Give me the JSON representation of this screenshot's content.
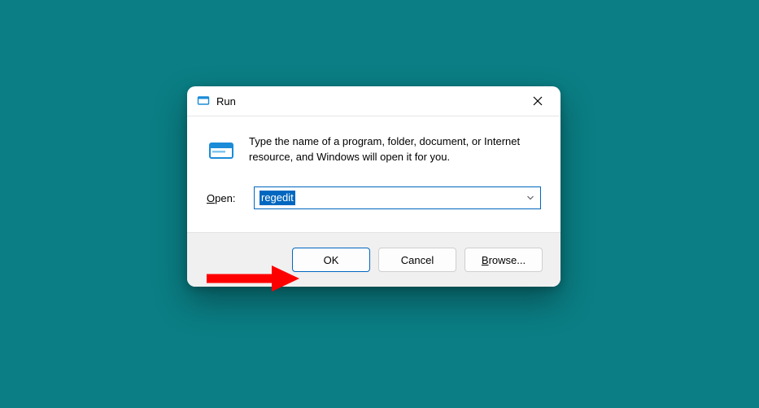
{
  "dialog": {
    "title": "Run",
    "instruction": "Type the name of a program, folder, document, or Internet resource, and Windows will open it for you.",
    "open_label_pre": "O",
    "open_label_post": "pen:",
    "input_value": "regedit",
    "buttons": {
      "ok": "OK",
      "cancel": "Cancel",
      "browse_pre": "B",
      "browse_post": "rowse..."
    }
  }
}
